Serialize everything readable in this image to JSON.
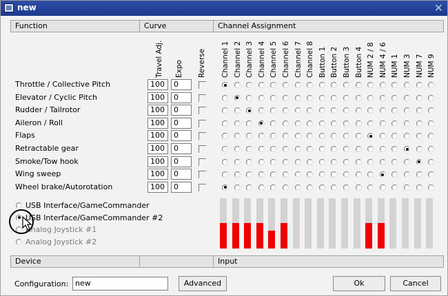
{
  "window": {
    "title": "new",
    "close_icon": "close-icon"
  },
  "headers": {
    "function": "Function",
    "curve": "Curve",
    "channel_assignment": "Channel Assignment",
    "device": "Device",
    "input": "Input"
  },
  "curve_columns": [
    "Travel Adj.",
    "Expo",
    "Reverse"
  ],
  "channel_columns": [
    "Channel 1",
    "Channel 2",
    "Channel 3",
    "Channel 4",
    "Channel 5",
    "Channel 6",
    "Channel 7",
    "Channel 8",
    "Button 1",
    "Button 2",
    "Button 3",
    "Button 4",
    "NUM 2 / 8",
    "NUM 4 / 6",
    "NUM 1",
    "NUM 3",
    "NUM 7",
    "NUM 9"
  ],
  "functions": [
    {
      "name": "Throttle / Collective Pitch",
      "travel": "100",
      "expo": "0",
      "reverse": false,
      "selected": 0
    },
    {
      "name": "Elevator / Cyclic Pitch",
      "travel": "100",
      "expo": "0",
      "reverse": false,
      "selected": 1
    },
    {
      "name": "Rudder / Tailrotor",
      "travel": "100",
      "expo": "0",
      "reverse": false,
      "selected": 2
    },
    {
      "name": "Aileron / Roll",
      "travel": "100",
      "expo": "0",
      "reverse": false,
      "selected": 3
    },
    {
      "name": "Flaps",
      "travel": "100",
      "expo": "0",
      "reverse": false,
      "selected": 12
    },
    {
      "name": "Retractable gear",
      "travel": "100",
      "expo": "0",
      "reverse": false,
      "selected": 15
    },
    {
      "name": "Smoke/Tow hook",
      "travel": "100",
      "expo": "0",
      "reverse": false,
      "selected": 16
    },
    {
      "name": "Wing sweep",
      "travel": "100",
      "expo": "0",
      "reverse": false,
      "selected": 13
    },
    {
      "name": "Wheel brake/Autorotation",
      "travel": "100",
      "expo": "0",
      "reverse": false,
      "selected": 0
    }
  ],
  "devices": [
    {
      "label": "USB Interface/GameCommander",
      "selected": false,
      "enabled": true
    },
    {
      "label": "USB Interface/GameCommander #2",
      "selected": true,
      "enabled": true
    },
    {
      "label": "Analog Joystick #1",
      "selected": false,
      "enabled": false
    },
    {
      "label": "Analog Joystick #2",
      "selected": false,
      "enabled": false
    }
  ],
  "input_levels": [
    0.5,
    0.5,
    0.5,
    0.5,
    0.35,
    0.5,
    0,
    0,
    0,
    0,
    0,
    0,
    0.5,
    0.5,
    0,
    0,
    0,
    0
  ],
  "colors": {
    "input_fill": "#ee0000",
    "input_track": "#d3d3d3",
    "titlebar": "#2d4ea5"
  },
  "footer": {
    "config_label": "Configuration:",
    "config_value": "new",
    "advanced": "Advanced",
    "ok": "Ok",
    "cancel": "Cancel"
  }
}
